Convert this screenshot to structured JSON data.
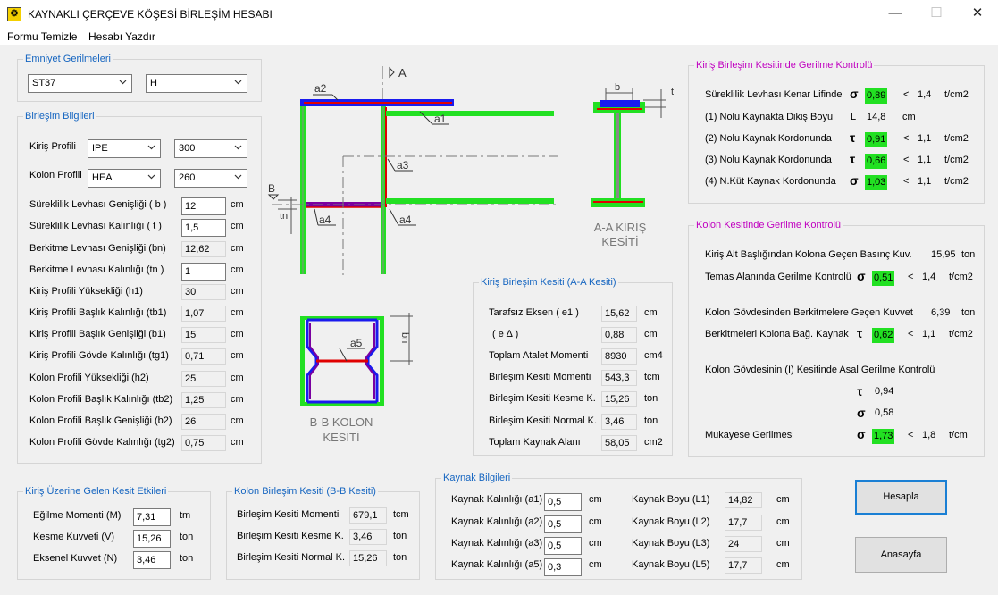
{
  "window": {
    "title": "KAYNAKLI ÇERÇEVE KÖŞESİ BİRLEŞİM HESABI",
    "minimize": "—",
    "maximize": "☐",
    "close": "✕"
  },
  "menu": {
    "clear": "Formu Temizle",
    "print": "Hesabı Yazdır"
  },
  "emniyet": {
    "title": "Emniyet Gerilmeleri",
    "steel": "ST37",
    "load": "H"
  },
  "birlesim": {
    "title": "Birleşim Bilgileri",
    "kiris_label": "Kiriş Profili",
    "kiris_type": "IPE",
    "kiris_size": "300",
    "kolon_label": "Kolon Profili",
    "kolon_type": "HEA",
    "kolon_size": "260",
    "rows": [
      {
        "label": "Süreklilik Levhası Genişliği ( b )",
        "value": "12",
        "unit": "cm"
      },
      {
        "label": "Süreklilik Levhası Kalınlığı ( t )",
        "value": "1,5",
        "unit": "cm"
      },
      {
        "label": "Berkitme Levhası Genişliği (bn)",
        "value": "12,62",
        "unit": "cm"
      },
      {
        "label": "Berkitme Levhası Kalınlığı (tn )",
        "value": "1",
        "unit": "cm"
      },
      {
        "label": "Kiriş Profili Yüksekliği (h1)",
        "value": "30",
        "unit": "cm"
      },
      {
        "label": "Kiriş Profili Başlık Kalınlığı (tb1)",
        "value": "1,07",
        "unit": "cm"
      },
      {
        "label": "Kiriş Profili Başlık Genişliği (b1)",
        "value": "15",
        "unit": "cm"
      },
      {
        "label": "Kiriş Profili Gövde Kalınlığı (tg1)",
        "value": "0,71",
        "unit": "cm"
      },
      {
        "label": "Kolon Profili Yüksekliği (h2)",
        "value": "25",
        "unit": "cm"
      },
      {
        "label": "Kolon Profili Başlık Kalınlığı (tb2)",
        "value": "1,25",
        "unit": "cm"
      },
      {
        "label": "Kolon Profili Başlık Genişliği (b2)",
        "value": "26",
        "unit": "cm"
      },
      {
        "label": "Kolon Profili Gövde Kalınlığı (tg2)",
        "value": "0,75",
        "unit": "cm"
      }
    ]
  },
  "diagram": {
    "a": "A",
    "b": "B",
    "a1": "a1",
    "a2": "a2",
    "a3": "a3",
    "a4": "a4",
    "a4b": "a4",
    "a5": "a5",
    "tn": "tn",
    "bsec": "b",
    "tsec": "t",
    "bn": "bn",
    "aa_line1": "A-A KİRİŞ",
    "aa_line2": "KESİTİ",
    "bb_line1": "B-B KOLON",
    "bb_line2": "KESİTİ"
  },
  "aa": {
    "title": "Kiriş Birleşim Kesiti (A-A Kesiti)",
    "rows": [
      {
        "label": "Tarafsız Eksen ( e1 )",
        "value": "15,62",
        "unit": "cm"
      },
      {
        "label": "( e ∆ )",
        "value": "0,88",
        "unit": "cm"
      },
      {
        "label": "Toplam Atalet Momenti",
        "value": "8930",
        "unit": "cm4"
      },
      {
        "label": "Birleşim Kesiti Momenti",
        "value": "543,3",
        "unit": "tcm"
      },
      {
        "label": "Birleşim Kesiti Kesme K.",
        "value": "15,26",
        "unit": "ton"
      },
      {
        "label": "Birleşim Kesiti Normal K.",
        "value": "3,46",
        "unit": "ton"
      },
      {
        "label": "Toplam Kaynak Alanı",
        "value": "58,05",
        "unit": "cm2"
      }
    ]
  },
  "kiris_kontrol": {
    "title": "Kiriş Birleşim Kesitinde Gerilme Kontrolü",
    "r1": {
      "label": "Süreklilik Levhası Kenar Lifinde",
      "sym": "σ",
      "value": "0,89",
      "op": "<",
      "limit": "1,4",
      "unit": "t/cm2"
    },
    "r2": {
      "label": "(1) Nolu Kaynakta Dikiş Boyu",
      "sym": "L",
      "value": "14,8",
      "unit": "cm"
    },
    "r3": {
      "label": "(2) Nolu Kaynak Kordonunda",
      "sym": "τ",
      "value": "0,91",
      "op": "<",
      "limit": "1,1",
      "unit": "t/cm2"
    },
    "r4": {
      "label": "(3) Nolu Kaynak Kordonunda",
      "sym": "τ",
      "value": "0,66",
      "op": "<",
      "limit": "1,1",
      "unit": "t/cm2"
    },
    "r5": {
      "label": "(4) N.Küt Kaynak Kordonunda",
      "sym": "σ",
      "value": "1,03",
      "op": "<",
      "limit": "1,1",
      "unit": "t/cm2"
    }
  },
  "kolon_kontrol": {
    "title": "Kolon Kesitinde Gerilme Kontrolü",
    "r1": {
      "label": "Kiriş Alt Başlığından Kolona Geçen Basınç Kuv.",
      "value": "15,95",
      "unit": "ton"
    },
    "r2": {
      "label": "Temas Alanında Gerilme Kontrolü",
      "sym": "σ",
      "value": "0,51",
      "op": "<",
      "limit": "1,4",
      "unit": "t/cm2"
    },
    "r3": {
      "label": "Kolon Gövdesinden Berkitmelere Geçen Kuvvet",
      "value": "6,39",
      "unit": "ton"
    },
    "r4": {
      "label": "Berkitmeleri Kolona Bağ. Kaynak",
      "sym": "τ",
      "value": "0,62",
      "op": "<",
      "limit": "1,1",
      "unit": "t/cm2"
    },
    "r5": {
      "label": "Kolon Gövdesinin (I) Kesitinde Asal Gerilme Kontrolü"
    },
    "r6": {
      "sym": "τ",
      "value": "0,94"
    },
    "r7": {
      "sym": "σ",
      "value": "0,58"
    },
    "r8": {
      "label": "Mukayese Gerilmesi",
      "sym": "σ",
      "value": "1,73",
      "op": "<",
      "limit": "1,8",
      "unit": "t/cm"
    }
  },
  "kesit_etki": {
    "title": "Kiriş Üzerine Gelen Kesit Etkileri",
    "rows": [
      {
        "label": "Eğilme Momenti (M)",
        "value": "7,31",
        "unit": "tm"
      },
      {
        "label": "Kesme Kuvveti  (V)",
        "value": "15,26",
        "unit": "ton"
      },
      {
        "label": "Eksenel Kuvvet (N)",
        "value": "3,46",
        "unit": "ton"
      }
    ]
  },
  "bb": {
    "title": "Kolon Birleşim Kesiti (B-B Kesiti)",
    "rows": [
      {
        "label": "Birleşim Kesiti Momenti",
        "value": "679,1",
        "unit": "tcm"
      },
      {
        "label": "Birleşim Kesiti Kesme K.",
        "value": "3,46",
        "unit": "ton"
      },
      {
        "label": "Birleşim Kesiti Normal K.",
        "value": "15,26",
        "unit": "ton"
      }
    ]
  },
  "kaynak": {
    "title": "Kaynak Bilgileri",
    "left": [
      {
        "label": "Kaynak Kalınlığı (a1)",
        "value": "0,5",
        "unit": "cm"
      },
      {
        "label": "Kaynak Kalınlığı (a2)",
        "value": "0,5",
        "unit": "cm"
      },
      {
        "label": "Kaynak Kalınlığı (a3)",
        "value": "0,5",
        "unit": "cm"
      },
      {
        "label": "Kaynak Kalınlığı (a5)",
        "value": "0,3",
        "unit": "cm"
      }
    ],
    "right": [
      {
        "label": "Kaynak Boyu (L1)",
        "value": "14,82",
        "unit": "cm"
      },
      {
        "label": "Kaynak Boyu (L2)",
        "value": "17,7",
        "unit": "cm"
      },
      {
        "label": "Kaynak Boyu (L3)",
        "value": "24",
        "unit": "cm"
      },
      {
        "label": "Kaynak Boyu (L5)",
        "value": "17,7",
        "unit": "cm"
      }
    ]
  },
  "buttons": {
    "hesapla": "Hesapla",
    "anasayfa": "Anasayfa"
  },
  "colors": {
    "weld_green": "#22e022",
    "flange_blue": "#1a1aee",
    "red": "#e00000",
    "purple": "#800080",
    "group_blue": "#1565c0",
    "group_magenta": "#c000c0"
  }
}
